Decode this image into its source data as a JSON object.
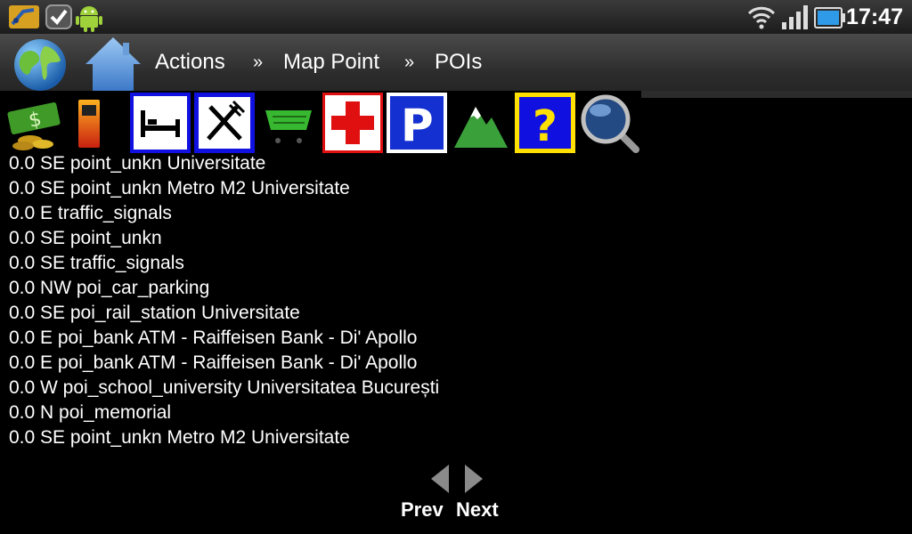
{
  "status_bar": {
    "clock": "17:47",
    "icons": [
      "app-icon",
      "tasks-check-icon",
      "android-icon",
      "wifi-icon",
      "signal-icon",
      "battery-icon"
    ]
  },
  "header": {
    "globe_icon": "globe-icon",
    "home_icon": "home-icon",
    "breadcrumb": [
      "Actions",
      "»",
      "Map Point",
      "»",
      "POIs"
    ]
  },
  "toolbar": {
    "items": [
      "money-icon",
      "fuel-icon",
      "lodging-icon",
      "restaurant-icon",
      "shopping-cart-icon",
      "hospital-icon",
      "parking-icon",
      "mountain-icon",
      "unknown-icon",
      "search-icon"
    ]
  },
  "poi_list": [
    "0.0 SE point_unkn Universitate",
    "0.0 SE point_unkn Metro M2 Universitate",
    "0.0 E traffic_signals",
    "0.0 SE point_unkn",
    "0.0 SE traffic_signals",
    "0.0 NW poi_car_parking",
    "0.0 SE poi_rail_station Universitate",
    "0.0 E poi_bank ATM - Raiffeisen Bank - Di' Apollo",
    "0.0 E poi_bank ATM - Raiffeisen Bank - Di' Apollo",
    "0.0 W poi_school_university Universitatea București",
    "0.0 N poi_memorial",
    "0.0 SE point_unkn Metro M2 Universitate"
  ],
  "pager": {
    "prev_label": "Prev",
    "next_label": "Next"
  },
  "colors": {
    "accent_blue": "#1010e0",
    "hospital_red": "#e01010",
    "unknown_yellow": "#ffe000"
  }
}
